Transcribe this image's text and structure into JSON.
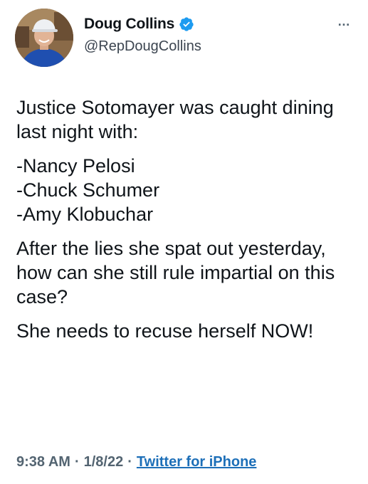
{
  "author": {
    "display_name": "Doug Collins",
    "handle": "@RepDougCollins",
    "avatar_icon": "profile-photo",
    "verified_icon": "verified-badge-icon",
    "verified_color": "#1d9bf0"
  },
  "menu": {
    "more_label": "…"
  },
  "tweet": {
    "line1": "Justice Sotomayer was caught dining last night with:",
    "list": [
      "-Nancy Pelosi",
      "-Chuck Schumer",
      "-Amy Klobuchar"
    ],
    "para2": "After the lies she spat out yesterday, how can she still rule impartial on this case?",
    "para3": "She needs to recuse herself NOW!"
  },
  "meta": {
    "time": "9:38 AM",
    "separator": "·",
    "date": "1/8/22",
    "source": "Twitter for iPhone"
  },
  "colors": {
    "text": "#0f1419",
    "secondary": "#536471",
    "link": "#1d6fb8"
  }
}
